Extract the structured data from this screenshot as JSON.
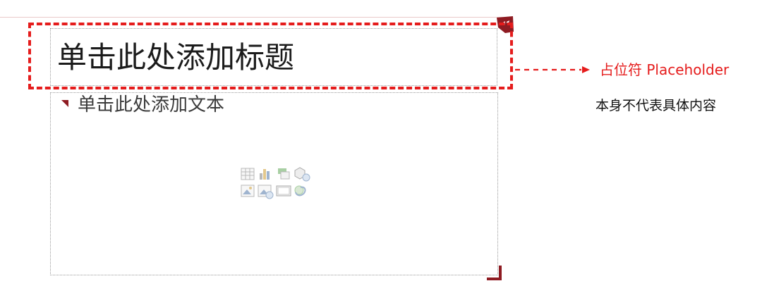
{
  "slide": {
    "title_placeholder": "单击此处添加标题",
    "body_placeholder": "单击此处添加文本",
    "insert_icons": [
      "table-icon",
      "chart-icon",
      "smartart-icon",
      "3d-model-icon",
      "picture-icon",
      "online-picture-icon",
      "video-icon",
      "icons-icon"
    ]
  },
  "annotation": {
    "label": "占位符 Placeholder",
    "description": "本身不代表具体内容"
  },
  "colors": {
    "highlight": "#e51c1c",
    "accent_dark_red": "#8e1b22",
    "placeholder_border": "#9a9a9a"
  }
}
